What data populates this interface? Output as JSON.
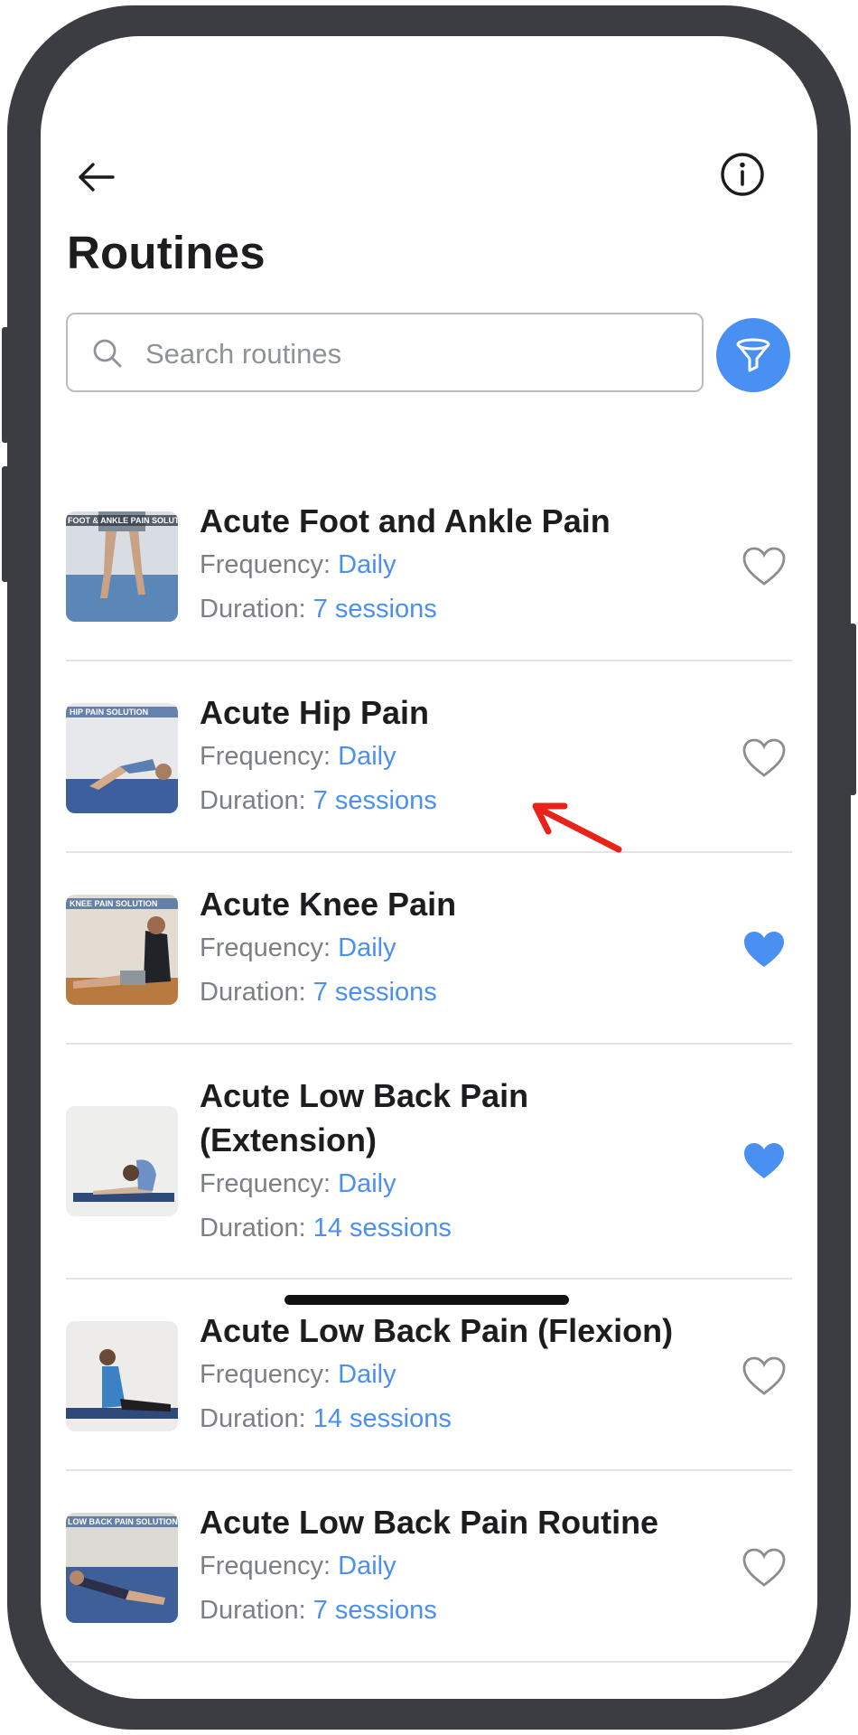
{
  "header": {
    "title": "Routines"
  },
  "search": {
    "placeholder": "Search routines",
    "value": ""
  },
  "labels": {
    "frequency": "Frequency: ",
    "duration": "Duration: "
  },
  "colors": {
    "accent": "#4a8ff2",
    "frame": "#3c3d42",
    "annotation_arrow": "#e8231a"
  },
  "routines": [
    {
      "title": "Acute Foot and Ankle Pain",
      "frequency": "Daily",
      "duration": "7 sessions",
      "favorite": false,
      "thumb_caption": "FOOT & ANKLE PAIN SOLUTION"
    },
    {
      "title": "Acute Hip Pain",
      "frequency": "Daily",
      "duration": "7 sessions",
      "favorite": false,
      "thumb_caption": "HIP PAIN SOLUTION"
    },
    {
      "title": "Acute Knee Pain",
      "frequency": "Daily",
      "duration": "7 sessions",
      "favorite": true,
      "thumb_caption": "KNEE PAIN SOLUTION"
    },
    {
      "title": "Acute Low Back Pain (Extension)",
      "frequency": "Daily",
      "duration": "14 sessions",
      "favorite": true,
      "thumb_caption": ""
    },
    {
      "title": "Acute Low Back Pain (Flexion)",
      "frequency": "Daily",
      "duration": "14 sessions",
      "favorite": false,
      "thumb_caption": ""
    },
    {
      "title": "Acute Low Back Pain Routine",
      "frequency": "Daily",
      "duration": "7 sessions",
      "favorite": false,
      "thumb_caption": "LOW BACK PAIN SOLUTION"
    }
  ]
}
